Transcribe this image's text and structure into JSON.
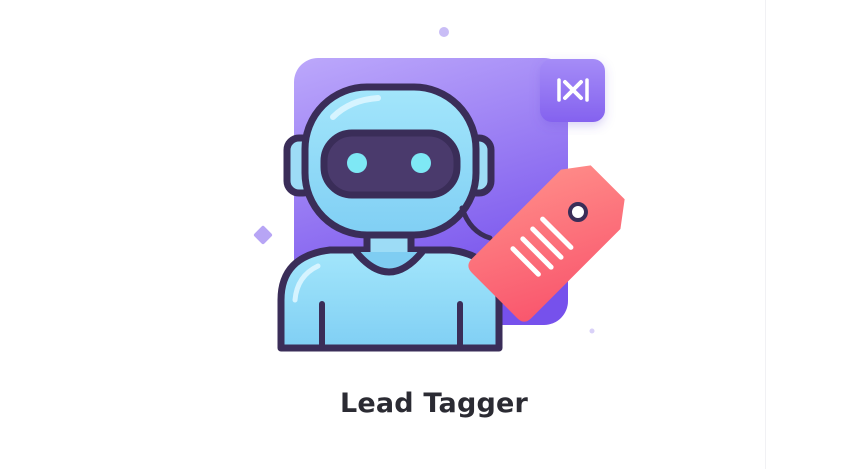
{
  "app": {
    "title": "Lead Tagger"
  },
  "icons": {
    "badge": "n8n-style-logo-icon",
    "mascot": "robot-icon",
    "tag": "price-tag-icon"
  },
  "colors": {
    "card_top": "#b9a4fb",
    "card_bottom": "#7a55ee",
    "robot_body": "#8fdcf8",
    "robot_outline": "#3a2d58",
    "visor": "#4a3a6c",
    "eyes": "#7ee8f5",
    "tag": "#fb6f7a",
    "tag_light": "#ffa19c",
    "title_text": "#2b2b33"
  }
}
